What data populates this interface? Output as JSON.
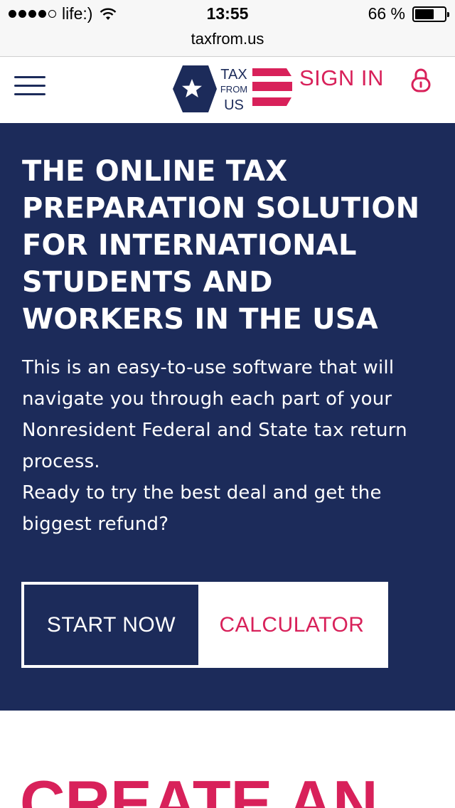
{
  "status_bar": {
    "carrier": "life:)",
    "time": "13:55",
    "battery_text": "66 %",
    "battery_level": 0.66
  },
  "browser": {
    "url": "taxfrom.us"
  },
  "header": {
    "logo": {
      "line1": "TAX",
      "line2": "FROM",
      "line3": "US"
    },
    "sign_in_label": "SIGN IN"
  },
  "hero": {
    "title": "THE ONLINE TAX PREPARATION SOLUTION FOR INTERNATIONAL STUDENTS AND WORKERS IN THE USA",
    "text1": "This is an easy-to-use software that will navigate you through each part of your Nonresident Federal and State tax return process.",
    "text2": "Ready to try the best deal and get the biggest refund?",
    "start_button": "START NOW",
    "calculator_button": "CALCULATOR"
  },
  "section2": {
    "heading": "CREATE AN"
  },
  "colors": {
    "navy": "#1c2b5a",
    "accent": "#d8215a"
  }
}
